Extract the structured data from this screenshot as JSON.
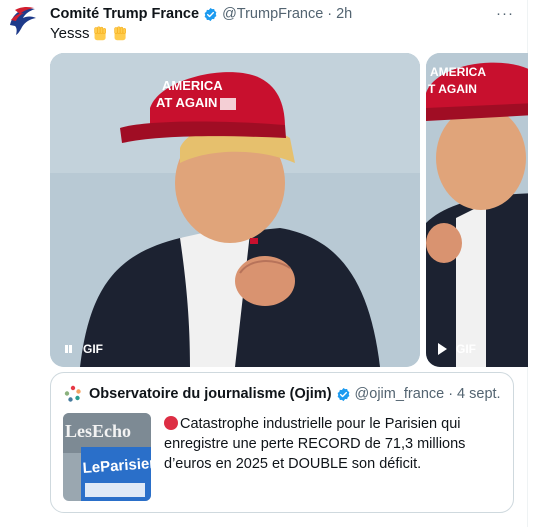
{
  "tweet": {
    "author_name": "Comité Trump France",
    "handle": "@TrumpFrance",
    "separator": "·",
    "time": "2h",
    "text": "Yesss",
    "more_label": "···"
  },
  "media": {
    "items": [
      {
        "badge": "GIF",
        "state": "playing"
      },
      {
        "badge": "GIF",
        "state": "paused"
      }
    ],
    "cap_text_1": "AMERICA",
    "cap_text_2": "AT AGAIN",
    "cap_text_2b": "T AGAIN"
  },
  "quote": {
    "author_name": "Observatoire du journalisme (Ojim)",
    "handle": "@ojim_france",
    "separator": "·",
    "time": "4 sept.",
    "text": "Catastrophe industrielle pour le Parisien qui enregistre une perte RECORD de 71,3 millions d’euros en 2025 et DOUBLE son déficit.",
    "thumb_text_1": "LesEcho",
    "thumb_text_2": "LeParisien"
  },
  "colors": {
    "verified": "#1d9bf0",
    "secondary_text": "#536471",
    "border": "#cfd9de",
    "red_emoji": "#dd2e44"
  }
}
